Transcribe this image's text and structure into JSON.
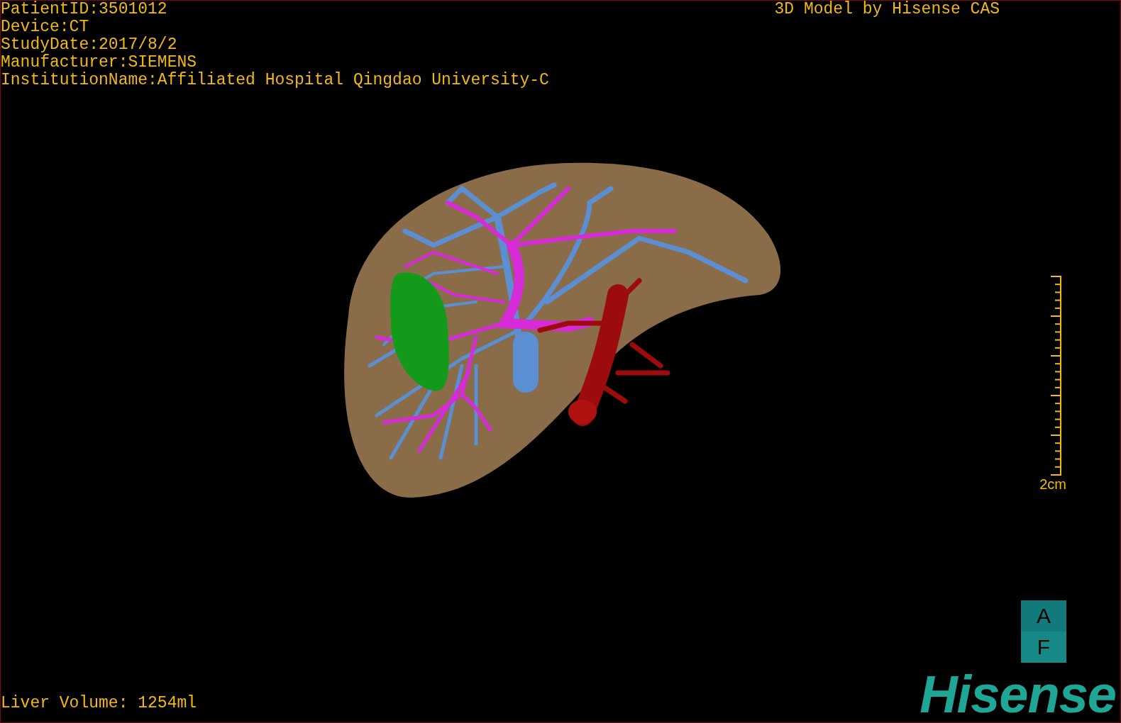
{
  "info_lines": [
    "PatientID:3501012",
    "Device:CT",
    "StudyDate:2017/8/2",
    "Manufacturer:SIEMENS",
    "InstitutionName:Affiliated Hospital Qingdao University-C"
  ],
  "title": "3D Model by Hisense CAS",
  "scale_bar": {
    "label": "2cm"
  },
  "orientation_cube": {
    "faces": [
      "A",
      "F"
    ]
  },
  "liver_volume": "Liver Volume: 1254ml",
  "logo": "Hisense"
}
